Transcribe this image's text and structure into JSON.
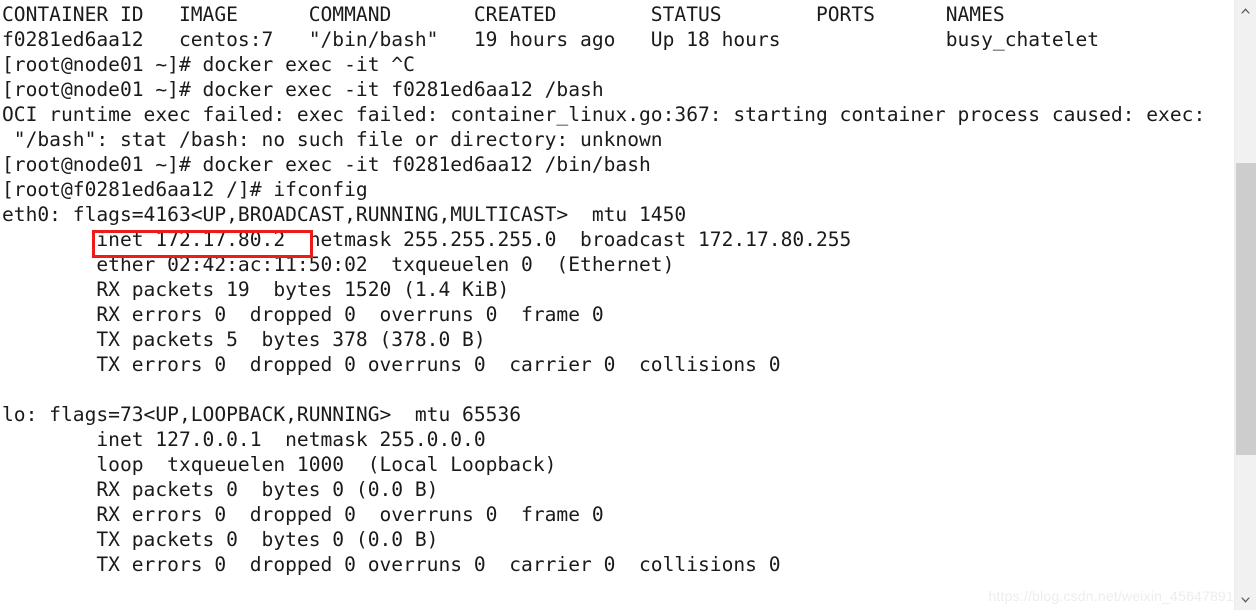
{
  "terminal": {
    "background_color": "#ffffff",
    "text_color": "#1a1a1a",
    "lines": [
      "CONTAINER ID   IMAGE      COMMAND       CREATED        STATUS        PORTS      NAMES",
      "f0281ed6aa12   centos:7   \"/bin/bash\"   19 hours ago   Up 18 hours              busy_chatelet",
      "[root@node01 ~]# docker exec -it ^C",
      "[root@node01 ~]# docker exec -it f0281ed6aa12 /bash",
      "OCI runtime exec failed: exec failed: container_linux.go:367: starting container process caused: exec:",
      " \"/bash\": stat /bash: no such file or directory: unknown",
      "[root@node01 ~]# docker exec -it f0281ed6aa12 /bin/bash",
      "[root@f0281ed6aa12 /]# ifconfig",
      "eth0: flags=4163<UP,BROADCAST,RUNNING,MULTICAST>  mtu 1450",
      "        inet 172.17.80.2  netmask 255.255.255.0  broadcast 172.17.80.255",
      "        ether 02:42:ac:11:50:02  txqueuelen 0  (Ethernet)",
      "        RX packets 19  bytes 1520 (1.4 KiB)",
      "        RX errors 0  dropped 0  overruns 0  frame 0",
      "        TX packets 5  bytes 378 (378.0 B)",
      "        TX errors 0  dropped 0 overruns 0  carrier 0  collisions 0",
      "",
      "lo: flags=73<UP,LOOPBACK,RUNNING>  mtu 65536",
      "        inet 127.0.0.1  netmask 255.0.0.0",
      "        loop  txqueuelen 1000  (Local Loopback)",
      "        RX packets 0  bytes 0 (0.0 B)",
      "        RX errors 0  dropped 0  overruns 0  frame 0",
      "        TX packets 0  bytes 0 (0.0 B)",
      "        TX errors 0  dropped 0 overruns 0  carrier 0  collisions 0"
    ]
  },
  "docker_ps_table": {
    "headers": [
      "CONTAINER ID",
      "IMAGE",
      "COMMAND",
      "CREATED",
      "STATUS",
      "PORTS",
      "NAMES"
    ],
    "rows": [
      [
        "f0281ed6aa12",
        "centos:7",
        "\"/bin/bash\"",
        "19 hours ago",
        "Up 18 hours",
        "",
        "busy_chatelet"
      ]
    ]
  },
  "commands": [
    "docker exec -it ^C",
    "docker exec -it f0281ed6aa12 /bash",
    "docker exec -it f0281ed6aa12 /bin/bash",
    "ifconfig"
  ],
  "prompts": {
    "host_prompt": "[root@node01 ~]#",
    "container_prompt": "[root@f0281ed6aa12 /]#"
  },
  "ifconfig": {
    "interfaces": [
      {
        "name": "eth0",
        "flags": "4163<UP,BROADCAST,RUNNING,MULTICAST>",
        "mtu": "1450",
        "inet": "172.17.80.2",
        "netmask": "255.255.255.0",
        "broadcast": "172.17.80.255",
        "ether": "02:42:ac:11:50:02",
        "txqueuelen": "0",
        "type": "(Ethernet)",
        "rx_packets": "19",
        "rx_bytes": "1520",
        "rx_bytes_human": "(1.4 KiB)",
        "rx_errors": "0",
        "rx_dropped": "0",
        "rx_overruns": "0",
        "rx_frame": "0",
        "tx_packets": "5",
        "tx_bytes": "378",
        "tx_bytes_human": "(378.0 B)",
        "tx_errors": "0",
        "tx_dropped": "0",
        "tx_overruns": "0",
        "tx_carrier": "0",
        "tx_collisions": "0"
      },
      {
        "name": "lo",
        "flags": "73<UP,LOOPBACK,RUNNING>",
        "mtu": "65536",
        "inet": "127.0.0.1",
        "netmask": "255.0.0.0",
        "loop_txqueuelen": "1000",
        "type": "(Local Loopback)",
        "rx_packets": "0",
        "rx_bytes": "0",
        "rx_bytes_human": "(0.0 B)",
        "rx_errors": "0",
        "rx_dropped": "0",
        "rx_overruns": "0",
        "rx_frame": "0",
        "tx_packets": "0",
        "tx_bytes": "0",
        "tx_bytes_human": "(0.0 B)",
        "tx_errors": "0",
        "tx_dropped": "0",
        "tx_overruns": "0",
        "tx_carrier": "0",
        "tx_collisions": "0"
      }
    ]
  },
  "error_message": {
    "line1": "OCI runtime exec failed: exec failed: container_linux.go:367: starting container process caused: exec:",
    "line2": " \"/bash\": stat /bash: no such file or directory: unknown"
  },
  "highlight": {
    "text": "inet 172.17.80.2",
    "color": "#ee1c18",
    "shape": "rectangle-outline"
  },
  "watermark": {
    "text": "https://blog.csdn.net/weixin_45647891",
    "color": "#ededed"
  },
  "scrollbar": {
    "orientation": "vertical",
    "up_arrow": "chevron-up-icon",
    "down_arrow": "chevron-down-icon",
    "track_color": "#f1f1f1",
    "thumb_color": "#cdcdcd"
  }
}
